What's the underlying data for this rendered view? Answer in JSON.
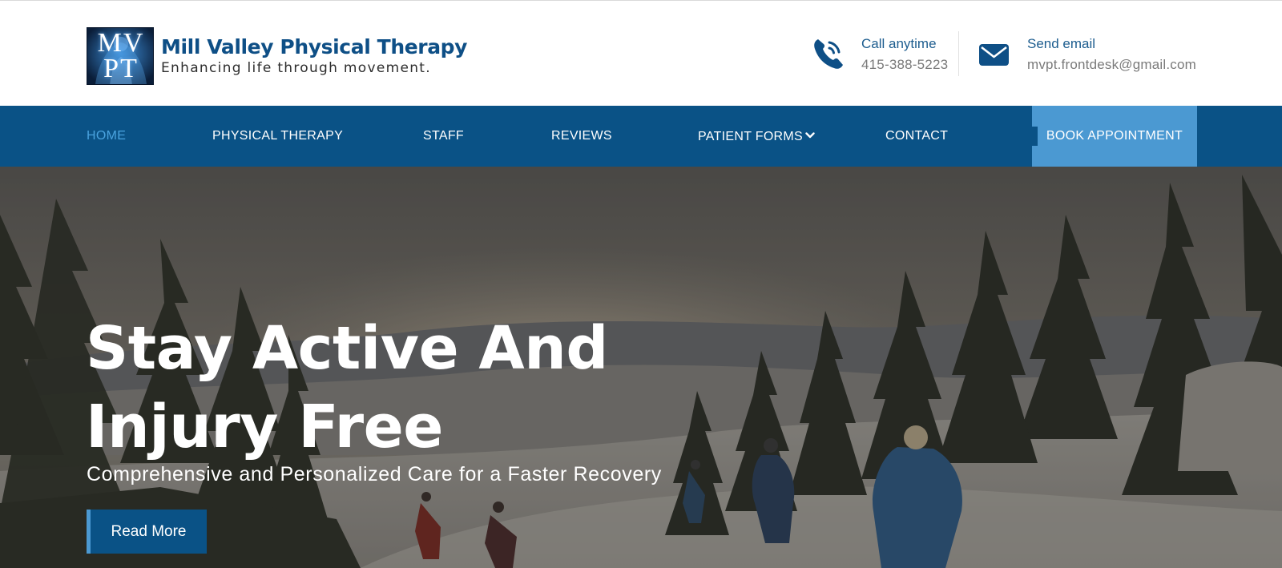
{
  "header": {
    "logo": {
      "monogram": "MVPT",
      "name": "Mill Valley Physical Therapy",
      "tagline": "Enhancing life through movement."
    },
    "call": {
      "label": "Call anytime",
      "value": "415-388-5223",
      "icon": "phone-icon"
    },
    "email": {
      "label": "Send email",
      "value": "mvpt.frontdesk@gmail.com",
      "icon": "envelope-icon"
    }
  },
  "nav": {
    "items": [
      {
        "label": "HOME",
        "active": true
      },
      {
        "label": "PHYSICAL THERAPY"
      },
      {
        "label": "STAFF"
      },
      {
        "label": "REVIEWS"
      },
      {
        "label": "PATIENT FORMS",
        "has_dropdown": true
      },
      {
        "label": "CONTACT"
      }
    ],
    "book_label": "BOOK APPOINTMENT"
  },
  "hero": {
    "title_line1": "Stay Active And",
    "title_line2": "Injury Free",
    "subtitle": "Comprehensive and Personalized Care for a Faster Recovery",
    "button_label": "Read More"
  },
  "colors": {
    "brand_dark": "#0a5286",
    "brand_light": "#4b99d2",
    "nav_active": "#4aa3df",
    "contact_label": "#1d5d8f"
  }
}
